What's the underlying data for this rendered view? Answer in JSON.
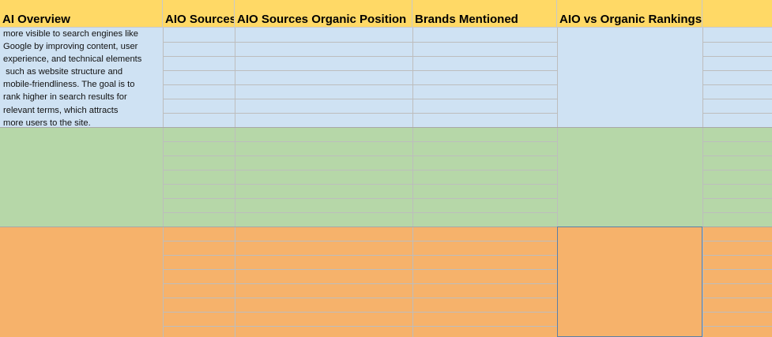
{
  "spreadsheet": {
    "columns": [
      {
        "id": "ai_overview",
        "label": "AI Overview"
      },
      {
        "id": "aio_sources",
        "label": "AIO Sources"
      },
      {
        "id": "aio_sources_organic_position",
        "label": "AIO Sources Organic Position"
      },
      {
        "id": "brands_mentioned",
        "label": "Brands Mentioned"
      },
      {
        "id": "aio_vs_organic_rankings",
        "label": "AIO vs Organic Rankings"
      },
      {
        "id": "extra",
        "label": ""
      }
    ],
    "overview_text_lines": [
      "more visible to search engines like",
      "Google by improving content, user",
      "experience, and technical elements",
      " such as website structure and",
      "mobile-friendliness. The goal is to",
      "rank higher in search results for",
      "relevant terms, which attracts",
      "more users to the site."
    ],
    "band_colors": {
      "header": "#ffd966",
      "blue": "#cfe2f3",
      "green": "#b6d7a8",
      "orange": "#f6b26b"
    },
    "selected_cell": "AIO vs Organic Rankings (orange band)"
  }
}
